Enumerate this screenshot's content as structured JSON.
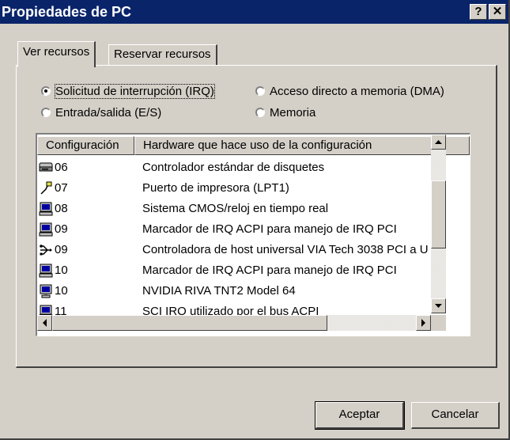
{
  "window": {
    "title": "Propiedades de PC",
    "help_button": "?",
    "close_button": "✕"
  },
  "tabs": [
    {
      "label": "Ver recursos",
      "active": true
    },
    {
      "label": "Reservar recursos",
      "active": false
    }
  ],
  "view_options": [
    {
      "label": "Solicitud de interrupción (IRQ)",
      "selected": true
    },
    {
      "label": "Acceso directo a memoria (DMA)",
      "selected": false
    },
    {
      "label": "Entrada/salida (E/S)",
      "selected": false
    },
    {
      "label": "Memoria",
      "selected": false
    }
  ],
  "resource_list": {
    "columns": [
      "Configuración",
      "Hardware que hace uso de la configuración"
    ],
    "rows": [
      {
        "icon": "floppy-drive-icon",
        "setting": "06",
        "hardware": "Controlador estándar de disquetes"
      },
      {
        "icon": "printer-port-icon",
        "setting": "07",
        "hardware": "Puerto de impresora (LPT1)"
      },
      {
        "icon": "computer-icon",
        "setting": "08",
        "hardware": "Sistema CMOS/reloj en tiempo real"
      },
      {
        "icon": "computer-icon",
        "setting": "09",
        "hardware": "Marcador de IRQ ACPI para manejo de IRQ PCI"
      },
      {
        "icon": "usb-icon",
        "setting": "09",
        "hardware": "Controladora de host universal VIA Tech 3038 PCI a U"
      },
      {
        "icon": "computer-icon",
        "setting": "10",
        "hardware": "Marcador de IRQ ACPI para manejo de IRQ PCI"
      },
      {
        "icon": "display-adapter-icon",
        "setting": "10",
        "hardware": "NVIDIA RIVA TNT2 Model 64"
      },
      {
        "icon": "computer-icon",
        "setting": "11",
        "hardware": "SCI IRQ utilizado por el bus ACPI"
      }
    ]
  },
  "buttons": {
    "ok": "Aceptar",
    "cancel": "Cancelar"
  },
  "colors": {
    "titlebar": "#0a246a",
    "face": "#d4d0c8"
  }
}
